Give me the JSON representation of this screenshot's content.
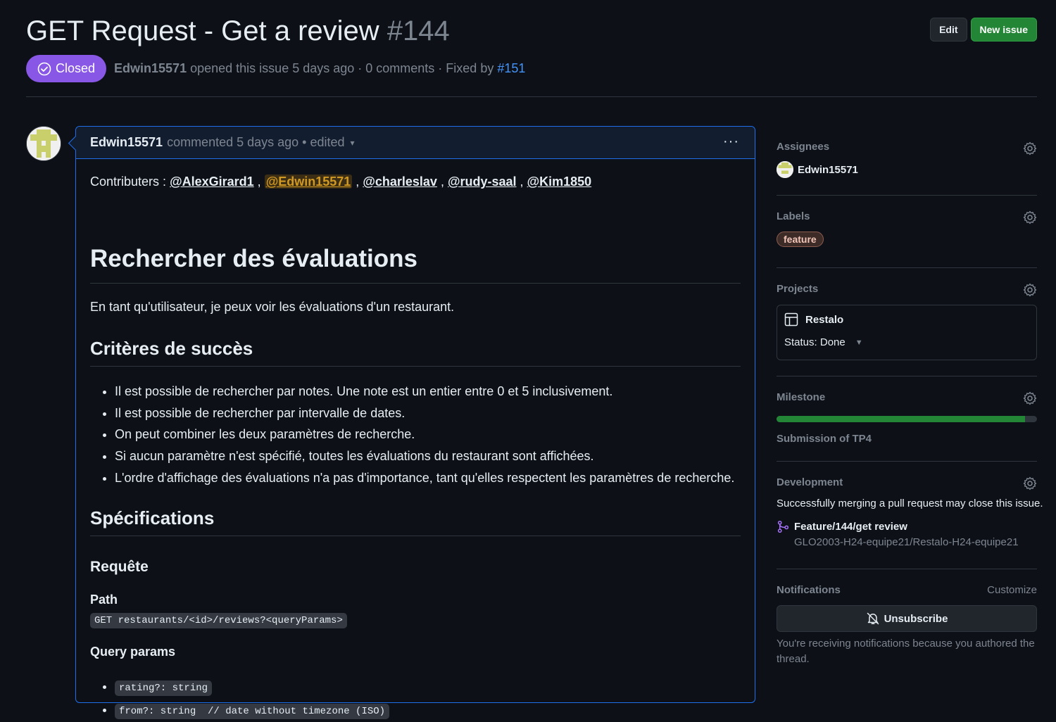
{
  "header": {
    "title": "GET Request - Get a review",
    "number": "#144",
    "edit_label": "Edit",
    "new_issue_label": "New issue"
  },
  "meta": {
    "state": "Closed",
    "author": "Edwin15571",
    "opened_text": "opened this issue 5 days ago · 0 comments · Fixed by",
    "fixed_by": "#151"
  },
  "comment": {
    "author": "Edwin15571",
    "time_text": "commented 5 days ago • edited",
    "contributors_prefix": "Contributers :",
    "mentions": [
      "@AlexGirard1",
      "@Edwin15571",
      "@charleslav",
      "@rudy-saal",
      "@Kim1850"
    ],
    "h1": "Rechercher des évaluations",
    "intro": "En tant qu'utilisateur, je peux voir les évaluations d'un restaurant.",
    "criteria_heading": "Critères de succès",
    "criteria": [
      "Il est possible de rechercher par notes. Une note est un entier entre 0 et 5 inclusivement.",
      "Il est possible de rechercher par intervalle de dates.",
      "On peut combiner les deux paramètres de recherche.",
      "Si aucun paramètre n'est spécifié, toutes les évaluations du restaurant sont affichées.",
      "L'ordre d'affichage des évaluations n'a pas d'importance, tant qu'elles respectent les paramètres de recherche."
    ],
    "spec_heading": "Spécifications",
    "request_heading": "Requête",
    "path_heading": "Path",
    "path_code": "GET restaurants/<id>/reviews?<queryParams>",
    "query_heading": "Query params",
    "query_params": [
      "rating?: string",
      "from?: string  // date without timezone (ISO)"
    ]
  },
  "sidebar": {
    "assignees_label": "Assignees",
    "assignee": "Edwin15571",
    "labels_label": "Labels",
    "label": "feature",
    "projects_label": "Projects",
    "project_name": "Restalo",
    "project_status": "Status: Done",
    "milestone_label": "Milestone",
    "milestone_progress": 0.955,
    "milestone_name": "Submission of TP4",
    "development_label": "Development",
    "development_text": "Successfully merging a pull request may close this issue.",
    "branch": "Feature/144/get review",
    "repo": "GLO2003-H24-equipe21/Restalo-H24-equipe21",
    "notifications_label": "Notifications",
    "customize_label": "Customize",
    "unsubscribe_label": "Unsubscribe",
    "notif_note": "You're receiving notifications because you authored the thread."
  },
  "colors": {
    "background": "#0d1117",
    "closed_badge": "#8957e5",
    "new_issue_button": "#238636",
    "link": "#4493f8",
    "comment_border": "#1f6feb"
  }
}
